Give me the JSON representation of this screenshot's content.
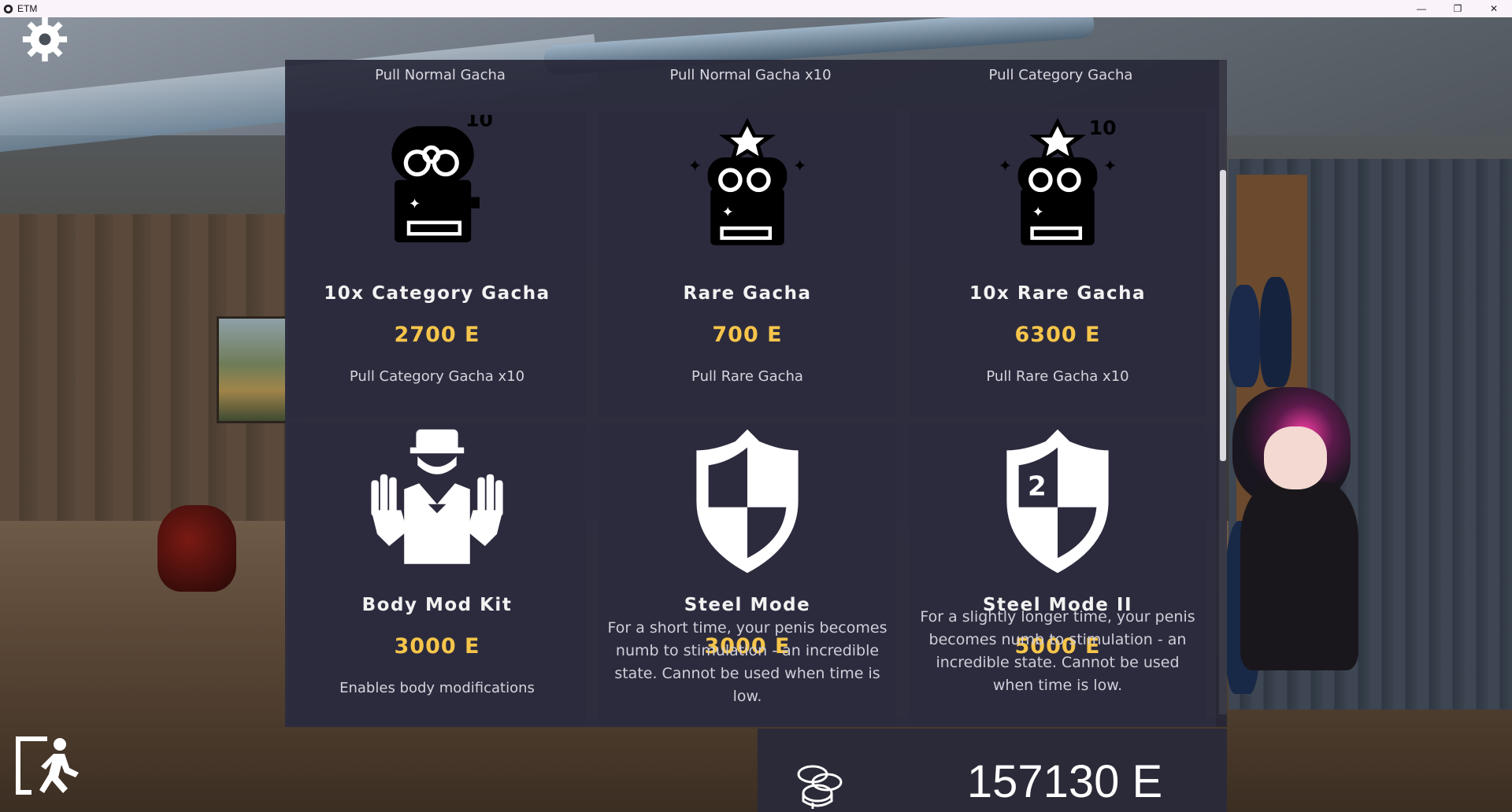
{
  "window": {
    "title": "ETM",
    "controls": [
      "—",
      "❐",
      "✕"
    ]
  },
  "shop": {
    "top_labels": [
      "Pull Normal Gacha",
      "Pull Normal Gacha x10",
      "Pull Category Gacha"
    ],
    "items": [
      {
        "icon": "gacha-machine-10-icon",
        "title": "10x Category Gacha",
        "price": "2700 E",
        "description": "Pull Category Gacha x10"
      },
      {
        "icon": "rare-gacha-icon",
        "title": "Rare Gacha",
        "price": "700 E",
        "description": "Pull Rare Gacha"
      },
      {
        "icon": "rare-gacha-10-icon",
        "title": "10x Rare Gacha",
        "price": "6300 E",
        "description": "Pull Rare Gacha x10"
      },
      {
        "icon": "body-mod-kit-icon",
        "title": "Body Mod Kit",
        "price": "3000 E",
        "description": "Enables body modifications"
      },
      {
        "icon": "shield-icon",
        "title": "Steel Mode",
        "price": "3000 E",
        "description": "For a short time, your penis becomes numb to stimulation - an incredible state. Cannot be used when time is low."
      },
      {
        "icon": "shield-2-icon",
        "title": "Steel Mode II",
        "price": "5000 E",
        "description": "For a slightly longer time, your penis becomes numb to stimulation - an incredible state. Cannot be used when time is low."
      }
    ]
  },
  "balance": {
    "icon": "coins-icon",
    "value": "157130 E"
  },
  "icons": {
    "settings": "gear-icon",
    "exit": "exit-icon"
  },
  "colors": {
    "price": "#f6c54a",
    "panel": "#2c2b3e",
    "title_bar": "#fbf3fa"
  }
}
